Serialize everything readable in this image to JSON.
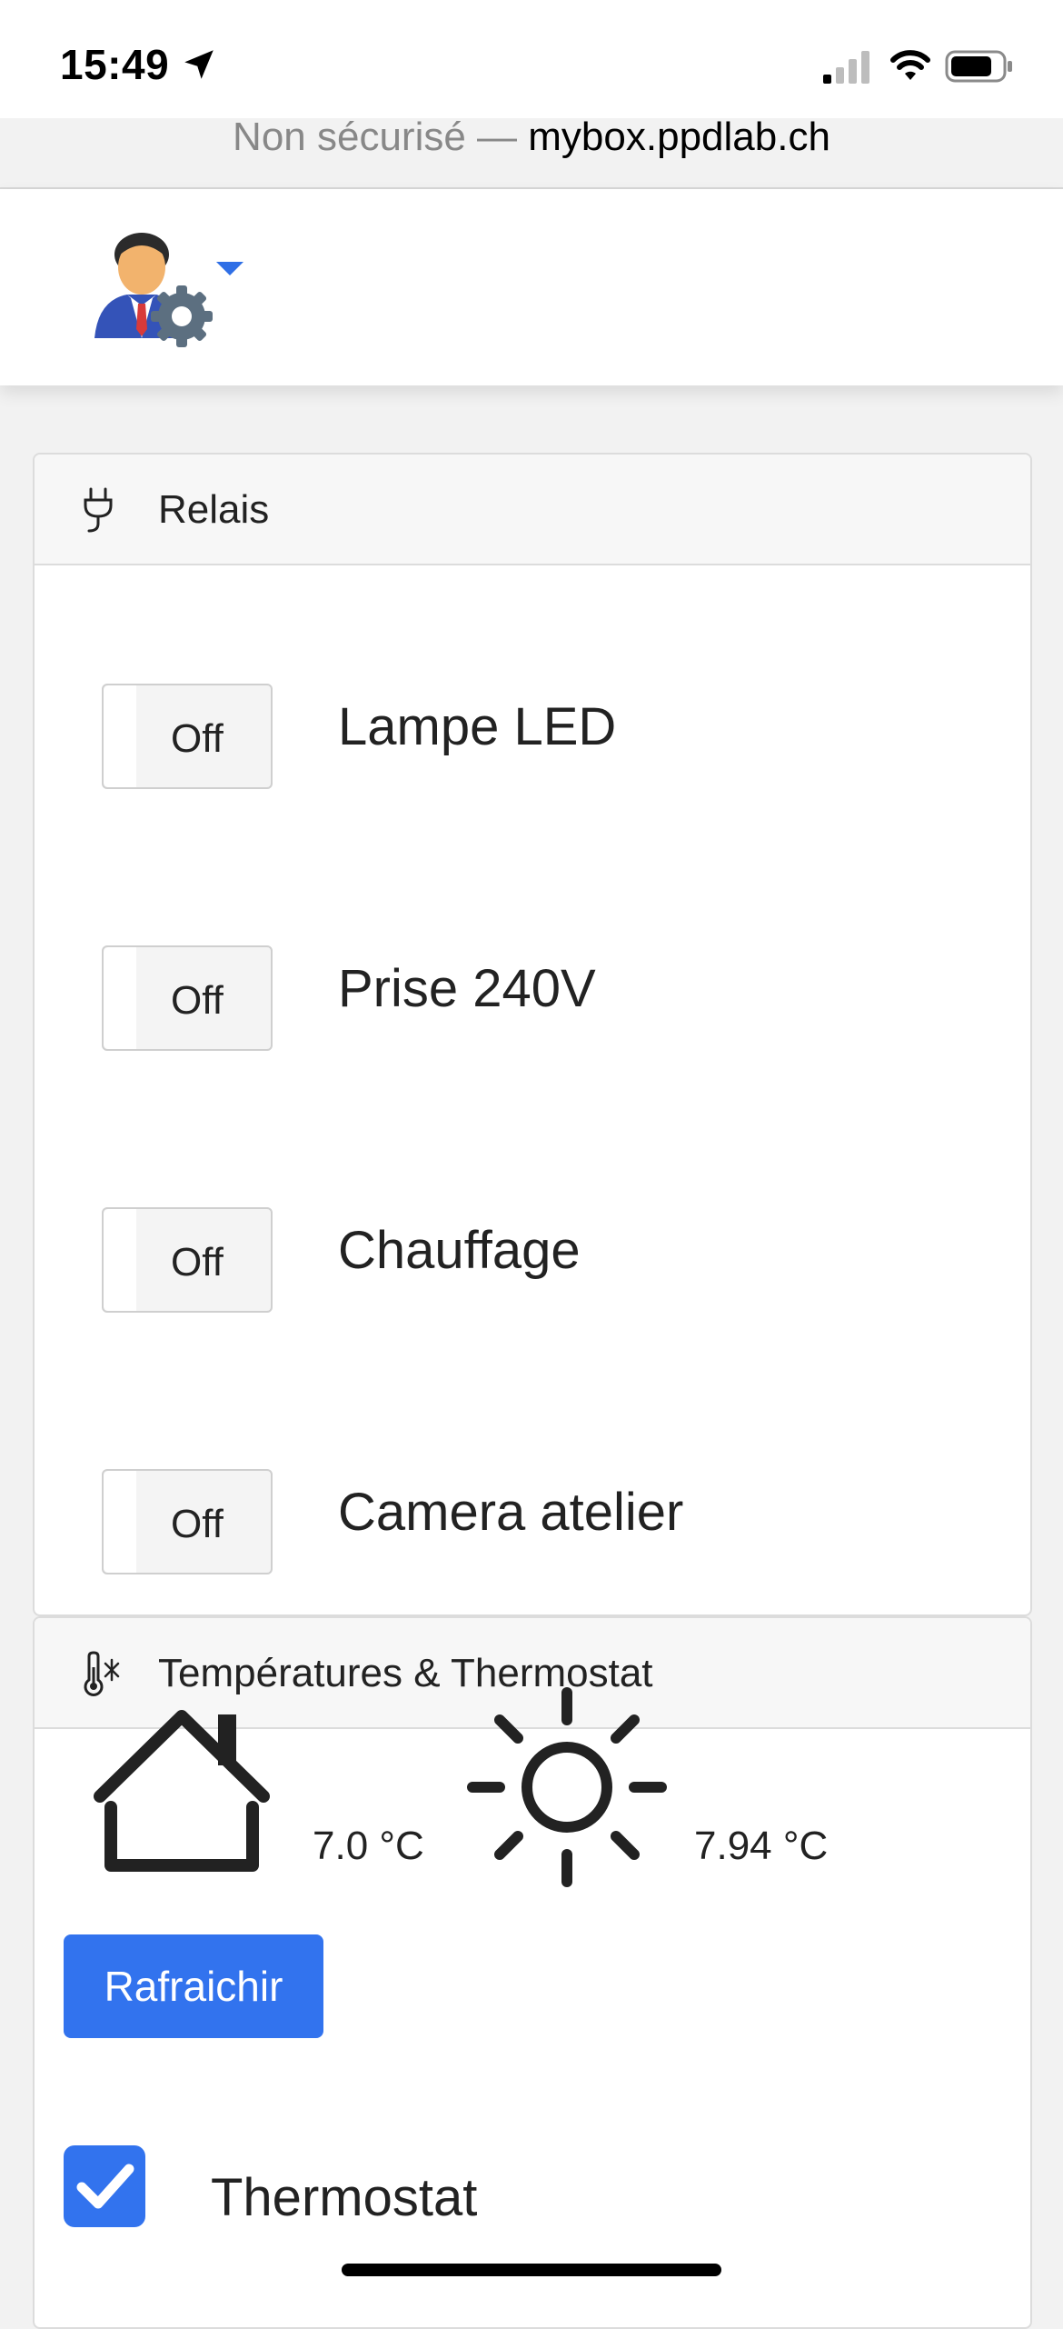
{
  "status_bar": {
    "time": "15:49",
    "location_icon": "location-arrow-icon",
    "signal_icon": "cell-signal-icon",
    "wifi_icon": "wifi-icon",
    "battery_icon": "battery-icon"
  },
  "browser": {
    "security_label": "Non sécurisé — ",
    "host": "mybox.ppdlab.ch"
  },
  "navbar": {
    "avatar_icon": "admin-user-gear-icon",
    "menu_caret": "caret-down-icon",
    "accent_color": "#2f6fe6"
  },
  "relais": {
    "title": "Relais",
    "icon": "plug-icon",
    "items": [
      {
        "state": "Off",
        "name": "Lampe LED"
      },
      {
        "state": "Off",
        "name": "Prise 240V"
      },
      {
        "state": "Off",
        "name": "Chauffage"
      },
      {
        "state": "Off",
        "name": "Camera atelier"
      }
    ]
  },
  "temperatures": {
    "title": "Températures & Thermostat",
    "icon": "thermometer-snow-icon",
    "indoor_icon": "house-icon",
    "indoor_value": "7.0 °C",
    "outdoor_icon": "sun-icon",
    "outdoor_value": "7.94 °C",
    "refresh_label": "Rafraichir",
    "button_color": "#3273ee",
    "thermostat_checked": true,
    "thermostat_label": "Thermostat"
  }
}
